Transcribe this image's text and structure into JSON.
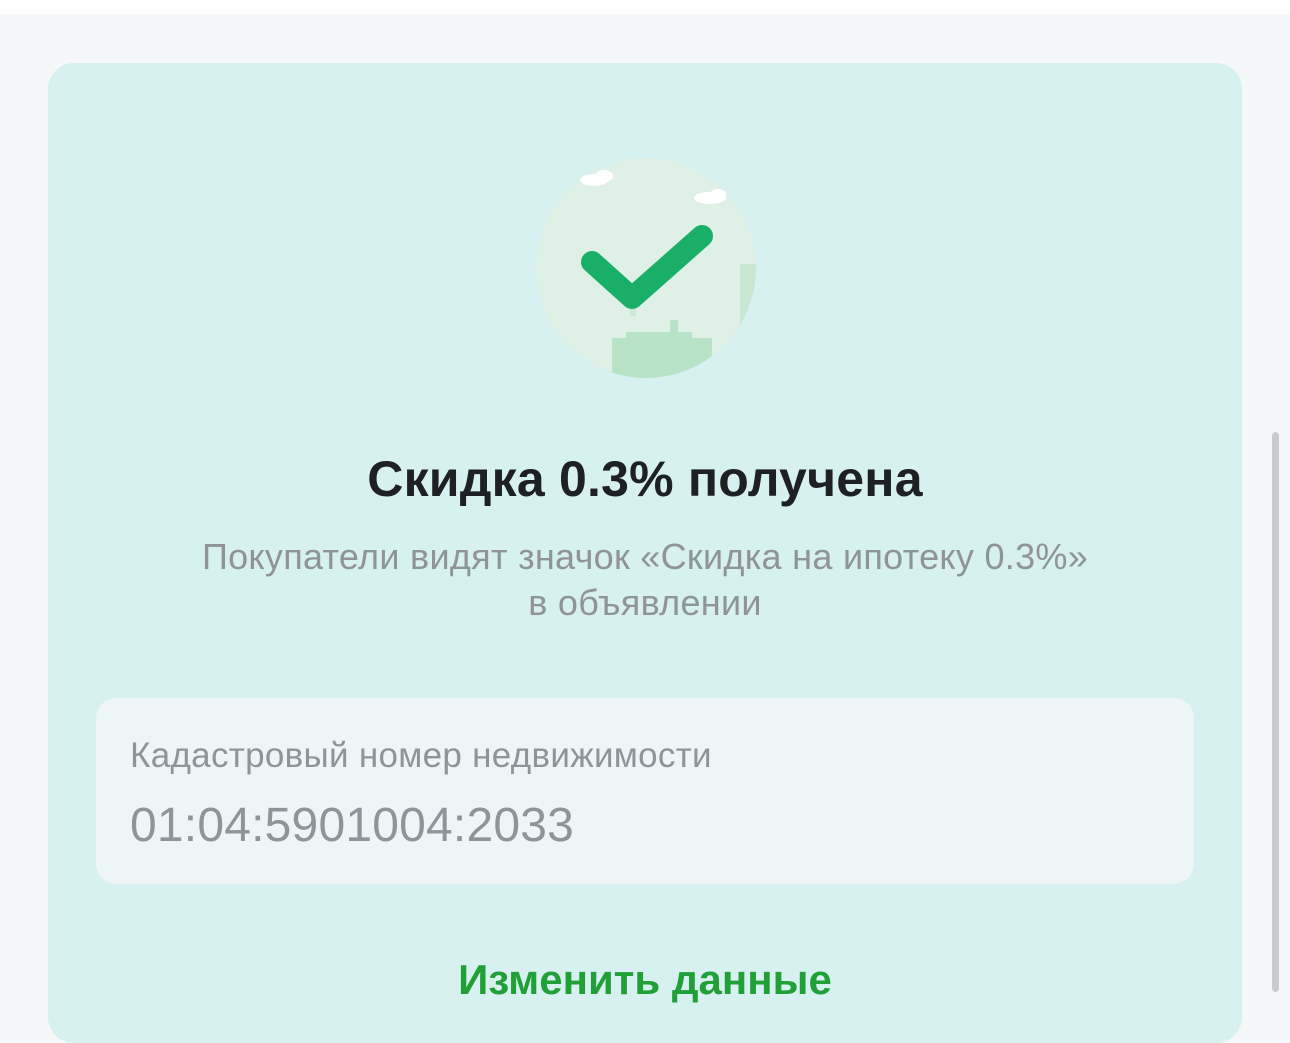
{
  "success": {
    "icon": "checkmark-icon",
    "title": "Скидка 0.3% получена",
    "subtitle_line1": "Покупатели видят значок «Скидка на ипотеку 0.3%»",
    "subtitle_line2": "в объявлении"
  },
  "cadastral_field": {
    "label": "Кадастровый номер недвижимости",
    "value": "01:04:5901004:2033"
  },
  "actions": {
    "edit_label": "Изменить данные"
  },
  "colors": {
    "card_background": "#d7f0f0",
    "accent_green": "#21a038",
    "check_green": "#1aaf67",
    "text_primary": "#1e2124",
    "text_secondary": "#8e9497"
  }
}
